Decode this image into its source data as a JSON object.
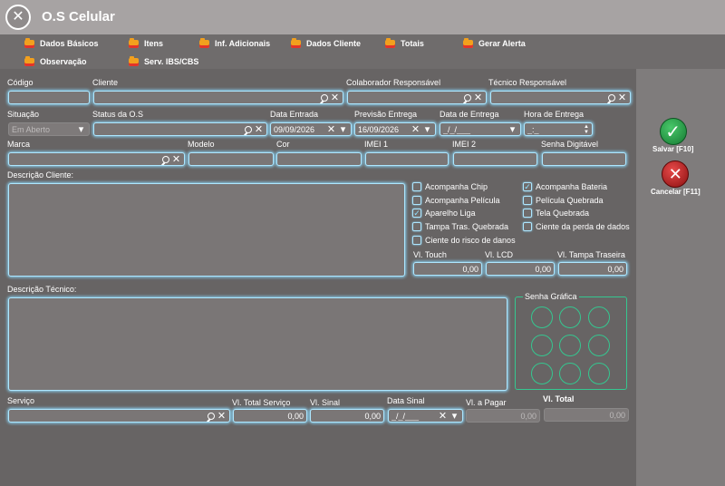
{
  "window": {
    "title": "O.S Celular"
  },
  "tabs": [
    "Dados Básicos",
    "Itens",
    "Inf. Adicionais",
    "Dados Cliente",
    "Totais",
    "Gerar Alerta",
    "Observação",
    "Serv. IBS/CBS"
  ],
  "labels": {
    "codigo": "Código",
    "cliente": "Cliente",
    "colaborador": "Colaborador Responsável",
    "tecnico": "Técnico Responsável",
    "situacao": "Situação",
    "status": "Status da O.S",
    "data_entrada": "Data Entrada",
    "previsao": "Previsão Entrega",
    "data_entrega": "Data de Entrega",
    "hora_entrega": "Hora de Entrega",
    "marca": "Marca",
    "modelo": "Modelo",
    "cor": "Cor",
    "imei1": "IMEI 1",
    "imei2": "IMEI 2",
    "senha_digital": "Senha Digitável",
    "descricao_cliente": "Descrição Cliente:",
    "descricao_tecnico": "Descrição Técnico:",
    "senha_grafica": "Senha Gráfica",
    "vl_touch": "Vl. Touch",
    "vl_lcd": "Vl. LCD",
    "vl_tampa": "Vl. Tampa Traseira",
    "servico": "Serviço",
    "vl_total_servico": "Vl. Total Serviço",
    "vl_sinal": "Vl. Sinal",
    "data_sinal": "Data Sinal",
    "vl_pagar": "Vl. a Pagar",
    "vl_total": "Vl. Total"
  },
  "values": {
    "situacao": "Em Aberto",
    "data_entrada": "09/09/2026",
    "previsao": "16/09/2026",
    "data_entrega": "_/_/___",
    "hora_entrega": "_:_",
    "vl_touch": "0,00",
    "vl_lcd": "0,00",
    "vl_tampa": "0,00",
    "vl_total_servico": "0,00",
    "vl_sinal": "0,00",
    "data_sinal": "_/_/___",
    "vl_pagar": "0,00",
    "vl_total": "0,00"
  },
  "checks": {
    "left": [
      {
        "label": "Acompanha Chip",
        "checked": false
      },
      {
        "label": "Acompanha Película",
        "checked": false
      },
      {
        "label": "Aparelho Liga",
        "checked": true
      },
      {
        "label": "Tampa Tras. Quebrada",
        "checked": false
      },
      {
        "label": "Ciente do risco de danos",
        "checked": false
      }
    ],
    "right": [
      {
        "label": "Acompanha Bateria",
        "checked": true
      },
      {
        "label": "Película Quebrada",
        "checked": false
      },
      {
        "label": "Tela Quebrada",
        "checked": false
      },
      {
        "label": "Ciente da perda de dados",
        "checked": false
      }
    ]
  },
  "actions": {
    "save": "Salvar [F10]",
    "cancel": "Cancelar [F11]"
  },
  "icons": {
    "close": "close-icon",
    "search": "search-icon",
    "clear": "clear-icon",
    "dropdown": "chevron-down-icon"
  },
  "colors": {
    "field_glow": "#aee7ff",
    "pattern": "#35c790",
    "folder": "#f2a01e"
  }
}
